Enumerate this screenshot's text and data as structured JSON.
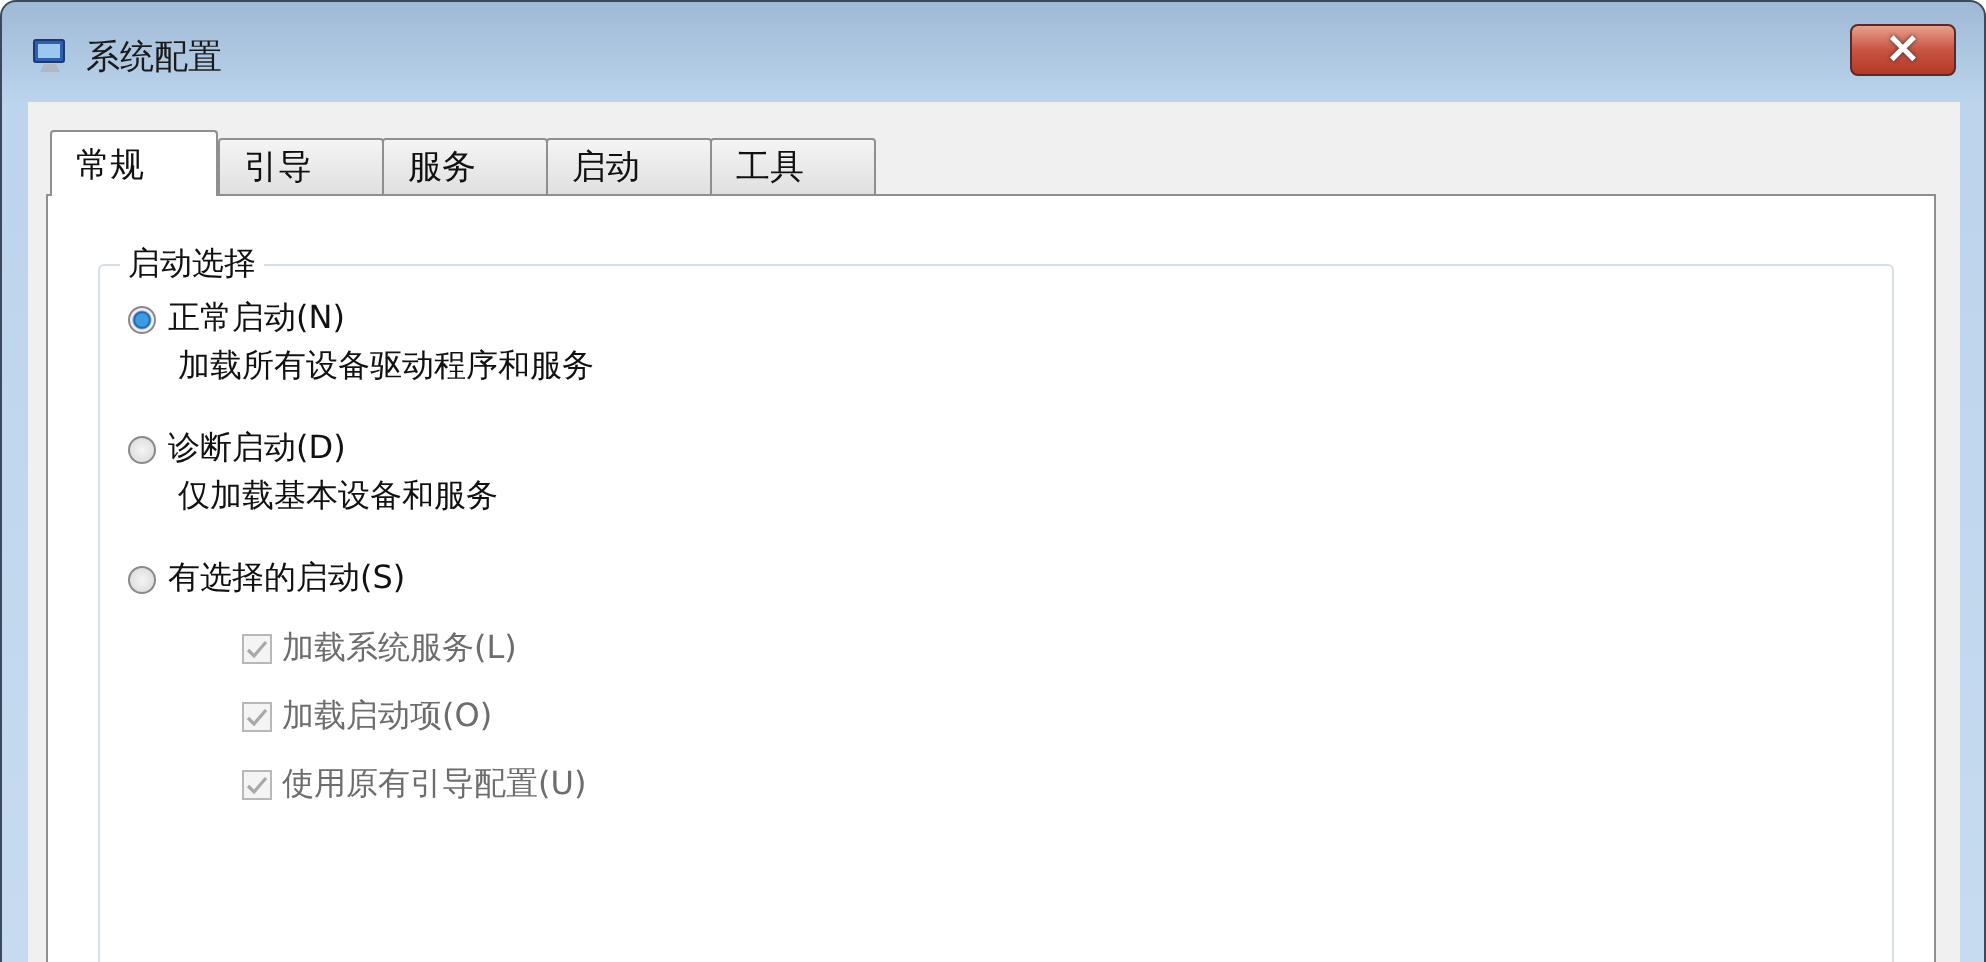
{
  "window": {
    "title": "系统配置",
    "close": "×"
  },
  "tabs": [
    {
      "label": "常规",
      "selected": true
    },
    {
      "label": "引导",
      "selected": false
    },
    {
      "label": "服务",
      "selected": false
    },
    {
      "label": "启动",
      "selected": false
    },
    {
      "label": "工具",
      "selected": false
    }
  ],
  "group": {
    "title": "启动选择",
    "options": [
      {
        "label": "正常启动(N)",
        "description": "加载所有设备驱动程序和服务",
        "selected": true
      },
      {
        "label": "诊断启动(D)",
        "description": "仅加载基本设备和服务",
        "selected": false
      },
      {
        "label": "有选择的启动(S)",
        "selected": false
      }
    ],
    "checkboxes": [
      {
        "label": "加载系统服务(L)",
        "checked": true,
        "disabled": true
      },
      {
        "label": "加载启动项(O)",
        "checked": true,
        "disabled": true
      },
      {
        "label": "使用原有引导配置(U)",
        "checked": true,
        "disabled": true
      }
    ]
  }
}
